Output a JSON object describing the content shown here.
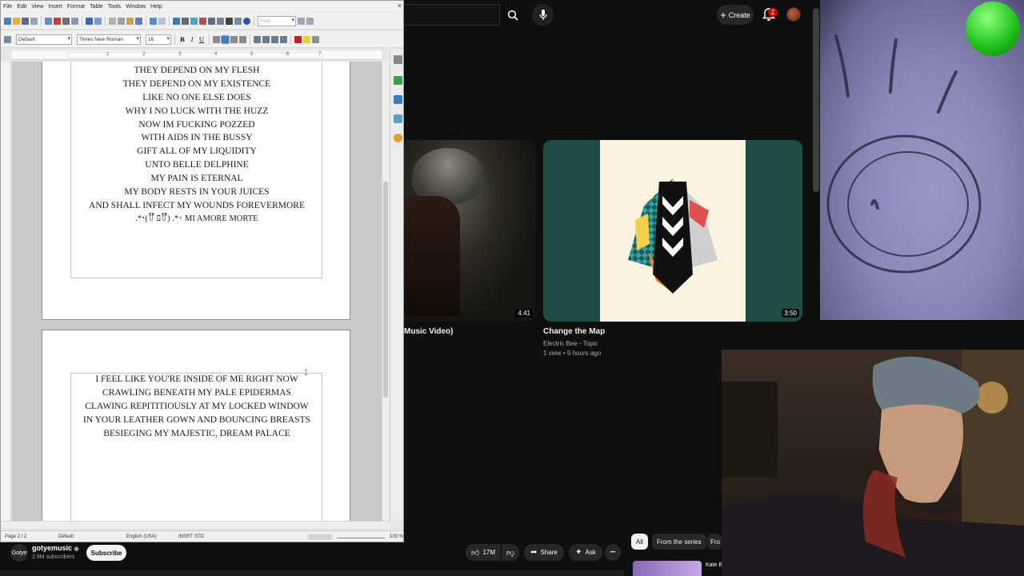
{
  "writer": {
    "menu": [
      "File",
      "Edit",
      "View",
      "Insert",
      "Format",
      "Table",
      "Tools",
      "Window",
      "Help"
    ],
    "close_glyph": "×",
    "find_placeholder": "Find",
    "paragraph_style": "Default",
    "font_name": "Times New Roman",
    "font_size": "16",
    "format_buttons": [
      "B",
      "I",
      "U"
    ],
    "ruler_numbers": [
      "1",
      "2",
      "3",
      "4",
      "5",
      "6",
      "7"
    ],
    "page1_lines": [
      "THEY DEPEND ON MY FLESH",
      "THEY DEPEND ON MY EXISTENCE",
      "LIKE NO ONE ELSE DOES",
      "WHY I NO LUCK WITH THE HUZZ",
      "NOW IM FUCKING POZZED",
      "WITH AIDS IN THE BUSSY",
      "GIFT ALL OF MY LIQUIDITY",
      "UNTO BELLE DELPHINE",
      "MY PAIN IS ETERNAL",
      "MY BODY RESTS IN YOUR JUICES",
      "AND SHALL INFECT MY WOUNDS FOREVERMORE",
      ".*･(꒦ິ ﾛ꒦ິ) .*･  MI AMORE MORTE"
    ],
    "page2_lines": [
      "I FEEL LIKE YOU'RE INSIDE OF ME RIGHT NOW",
      "CRAWLING BENEATH MY PALE EPIDERMAS",
      "CLAWING REPITITIOUSLY AT MY LOCKED WINDOW",
      "IN YOUR LEATHER GOWN AND BOUNCING BREASTS",
      "BESIEGING MY MAJESTIC, DREAM PALACE"
    ],
    "status": {
      "page": "Page 2 / 2",
      "style": "Default",
      "language": "English (USA)",
      "mode": "INSRT",
      "selection": "STD",
      "zoom": "100 %"
    }
  },
  "youtube": {
    "create_label": "Create",
    "notification_count": "2",
    "videos": [
      {
        "title": "Music Video)",
        "duration": "4:41"
      },
      {
        "title": "Change the Map",
        "channel": "Electric Bee - Topic",
        "meta": "1 view • 9 hours ago",
        "duration": "3:50"
      }
    ],
    "channel": {
      "name": "gotyemusic",
      "verified_glyph": "◉",
      "subscribers": "2.9M subscribers",
      "avatar_text": "Gotye"
    },
    "subscribe_label": "Subscribe",
    "like_count": "17M",
    "share_label": "Share",
    "ask_label": "Ask",
    "more_glyph": "•••",
    "chips": [
      "All",
      "From the series",
      "Fro"
    ],
    "side_video_title": "Kate B Hill - A",
    "colors": {
      "background": "#0f0f0f",
      "pill": "#272727",
      "badge": "#cc0000",
      "thumb_teal": "#1d4b46"
    }
  }
}
